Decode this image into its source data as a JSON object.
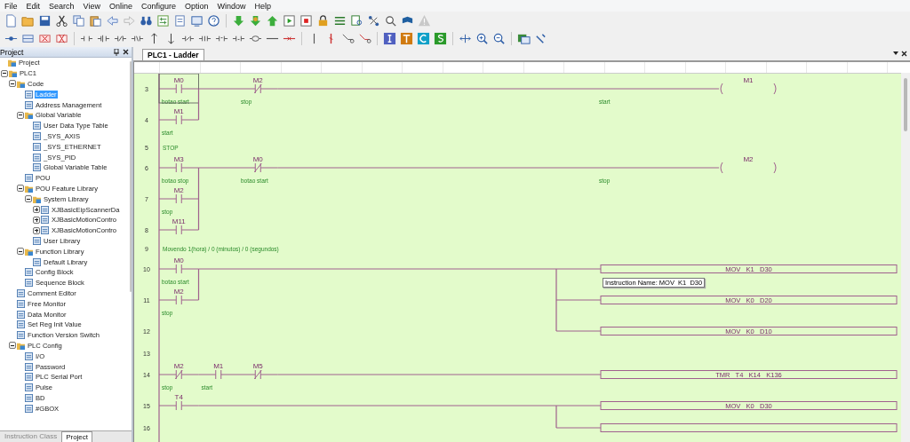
{
  "menu": [
    "File",
    "Edit",
    "Search",
    "View",
    "Online",
    "Configure",
    "Option",
    "Window",
    "Help"
  ],
  "project_panel": {
    "title": "Project",
    "tree": [
      {
        "label": "Project",
        "selected": false,
        "children": [
          {
            "label": "PLC1",
            "selected": false,
            "expanded": true,
            "children": [
              {
                "label": "Code",
                "selected": false,
                "expanded": true,
                "children": [
                  {
                    "label": "Ladder",
                    "selected": true
                  },
                  {
                    "label": "Address Management",
                    "selected": false
                  },
                  {
                    "label": "Global Variable",
                    "selected": false,
                    "expanded": true,
                    "children": [
                      {
                        "label": "User Data Type Table",
                        "selected": false
                      },
                      {
                        "label": "_SYS_AXIS",
                        "selected": false
                      },
                      {
                        "label": "_SYS_ETHERNET",
                        "selected": false
                      },
                      {
                        "label": "_SYS_PID",
                        "selected": false
                      },
                      {
                        "label": "Global Variable Table",
                        "selected": false
                      }
                    ]
                  },
                  {
                    "label": "POU",
                    "selected": false
                  },
                  {
                    "label": "POU Feature Library",
                    "selected": false,
                    "expanded": true,
                    "children": [
                      {
                        "label": "System Library",
                        "selected": false,
                        "expanded": true,
                        "children": [
                          {
                            "label": "XJBasicEipScannerDa",
                            "selected": false,
                            "expanded": false
                          },
                          {
                            "label": "XJBasicMotionContro",
                            "selected": false,
                            "expanded": false
                          },
                          {
                            "label": "XJBasicMotionContro",
                            "selected": false,
                            "expanded": false
                          }
                        ]
                      },
                      {
                        "label": "User Library",
                        "selected": false
                      }
                    ]
                  },
                  {
                    "label": "Function Library",
                    "selected": false,
                    "expanded": true,
                    "children": [
                      {
                        "label": "Default Library",
                        "selected": false
                      }
                    ]
                  },
                  {
                    "label": "Config Block",
                    "selected": false
                  },
                  {
                    "label": "Sequence Block",
                    "selected": false
                  }
                ]
              },
              {
                "label": "Comment Editor",
                "selected": false
              },
              {
                "label": "Free Monitor",
                "selected": false
              },
              {
                "label": "Data Monitor",
                "selected": false
              },
              {
                "label": "Set Reg Init Value",
                "selected": false
              },
              {
                "label": "Function Version Switch",
                "selected": false
              },
              {
                "label": "PLC Config",
                "selected": false,
                "expanded": true,
                "children": [
                  {
                    "label": "I/O",
                    "selected": false
                  },
                  {
                    "label": "Password",
                    "selected": false
                  },
                  {
                    "label": "PLC Serial Port",
                    "selected": false
                  },
                  {
                    "label": "Pulse",
                    "selected": false
                  },
                  {
                    "label": "BD",
                    "selected": false
                  },
                  {
                    "label": "#GBOX",
                    "selected": false
                  }
                ]
              }
            ]
          }
        ]
      }
    ],
    "bottom_tabs": [
      {
        "label": "Instruction Class",
        "selected": false
      },
      {
        "label": "Project",
        "selected": true
      }
    ]
  },
  "editor": {
    "tab": "PLC1 - Ladder",
    "ladder": {
      "rows": [
        {
          "number": "3",
          "kind": "rung",
          "cells": [
            {
              "kind": "no",
              "address": "M0",
              "comment": "botao start",
              "cursor": true
            },
            {
              "kind": "wire"
            },
            {
              "kind": "nc",
              "address": "M2",
              "comment": "stop"
            },
            {
              "kind": "coil",
              "address": "M1",
              "comment": "start"
            }
          ]
        },
        {
          "number": "4",
          "kind": "rung",
          "joins_above": true,
          "cells": [
            {
              "kind": "no",
              "address": "M1",
              "comment": "start"
            }
          ]
        },
        {
          "number": "5",
          "kind": "comment",
          "text": "STOP"
        },
        {
          "number": "6",
          "kind": "rung",
          "cells": [
            {
              "kind": "no",
              "address": "M3",
              "comment": "botao stop"
            },
            {
              "kind": "wire"
            },
            {
              "kind": "nc",
              "address": "M0",
              "comment": "botao start"
            },
            {
              "kind": "coil",
              "address": "M2",
              "comment": "stop"
            }
          ]
        },
        {
          "number": "7",
          "kind": "rung",
          "joins_above": true,
          "cells": [
            {
              "kind": "no",
              "address": "M2",
              "comment": "stop"
            }
          ]
        },
        {
          "number": "8",
          "kind": "rung",
          "joins_above": true,
          "cells": [
            {
              "kind": "no",
              "address": "M11"
            }
          ]
        },
        {
          "number": "9",
          "kind": "comment",
          "text": "Movendo 1(hora) / 0 (minutos) / 0 (segundos)"
        },
        {
          "number": "10",
          "kind": "rung",
          "cells": [
            {
              "kind": "no",
              "address": "M0",
              "comment": "botao start"
            },
            {
              "kind": "box",
              "text": "MOV   K1   D30"
            }
          ]
        },
        {
          "number": "11",
          "kind": "rung",
          "joins_above": true,
          "output_branch": true,
          "cells": [
            {
              "kind": "no",
              "address": "M2",
              "comment": "stop"
            },
            {
              "kind": "box",
              "text": "MOV   K0   D20"
            }
          ]
        },
        {
          "number": "12",
          "kind": "rung",
          "output_branch": true,
          "cells": [
            {
              "kind": "box",
              "text": "MOV   K0   D10"
            }
          ]
        },
        {
          "number": "13",
          "kind": "empty"
        },
        {
          "number": "14",
          "kind": "rung",
          "cells": [
            {
              "kind": "nc",
              "address": "M2",
              "comment": "stop"
            },
            {
              "kind": "no",
              "address": "M1",
              "comment": "start"
            },
            {
              "kind": "nc",
              "address": "M5"
            },
            {
              "kind": "box",
              "text": "TMR   T4   K14   K136"
            }
          ]
        },
        {
          "number": "15",
          "kind": "rung",
          "cells": [
            {
              "kind": "no",
              "address": "T4"
            },
            {
              "kind": "box",
              "text": "MOV   K0   D30"
            }
          ]
        },
        {
          "number": "16",
          "kind": "rung",
          "output_branch": true,
          "cells": [
            {
              "kind": "box"
            }
          ]
        }
      ],
      "tooltip": "Instruction Name: MOV  K1  D30"
    }
  }
}
